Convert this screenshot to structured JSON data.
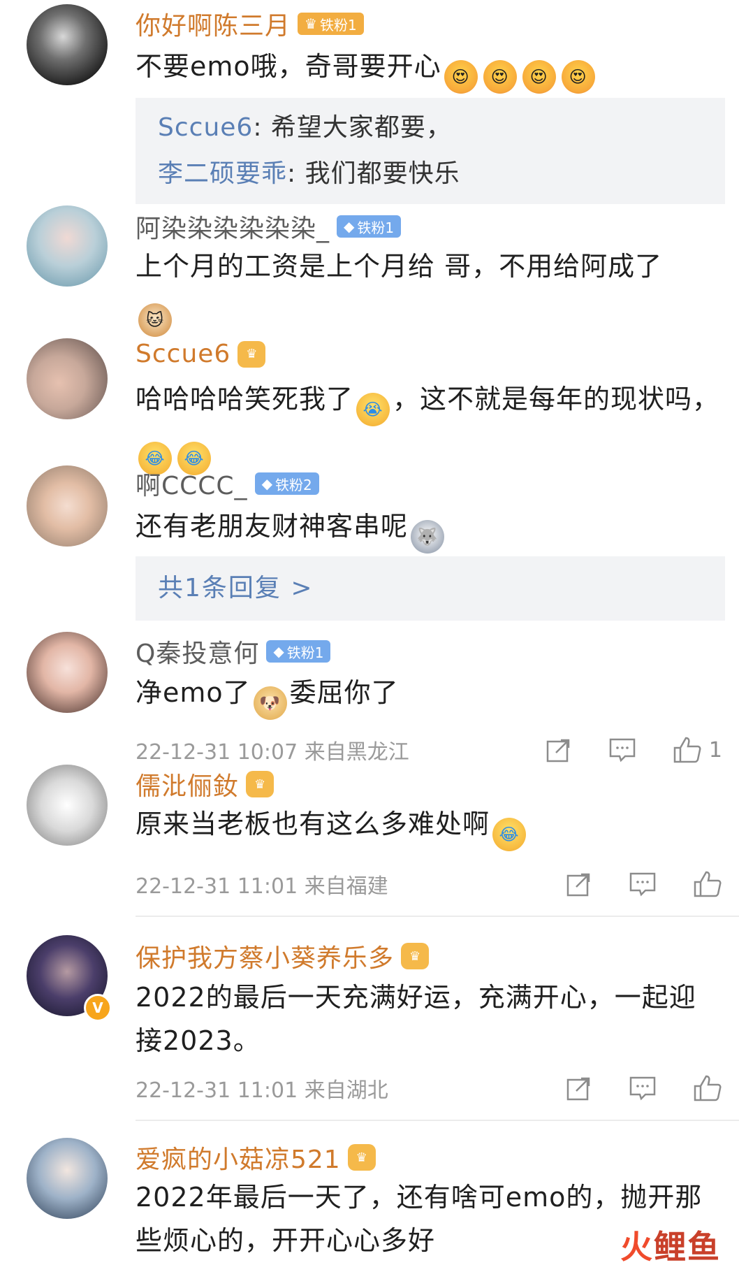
{
  "comments": [
    {
      "username": "你好啊陈三月",
      "badge": "铁粉1",
      "text": "不要emo哦，奇哥要开心",
      "replies": [
        {
          "user": "Sccue6",
          "text": ": 希望大家都要，"
        },
        {
          "user": "李二硕要乖",
          "text": ": 我们都要快乐"
        }
      ]
    },
    {
      "username": "阿染染染染染染_",
      "badge": "铁粉1",
      "text": "上个月的工资是上个月给 哥，不用给阿成了"
    },
    {
      "username": "Sccue6",
      "text_before": "哈哈哈哈笑死我了",
      "text_after": "，这不就是每年的现状吗，"
    },
    {
      "username": "啊CCCC_",
      "badge": "铁粉2",
      "text": "还有老朋友财神客串呢",
      "more_replies": "共1条回复 >"
    },
    {
      "username": "Q秦投意何",
      "badge": "铁粉1",
      "text_before": "净emo了",
      "text_after": "委屈你了",
      "meta": "22-12-31 10:07 来自黑龙江",
      "likes": "1"
    },
    {
      "username": "儒沘俪釹",
      "text": "原来当老板也有这么多难处啊",
      "meta": "22-12-31 11:01 来自福建"
    },
    {
      "username": "保护我方蔡小葵养乐多",
      "text": "2022的最后一天充满好运，充满开心，一起迎接2023。",
      "meta": "22-12-31 11:01 来自湖北"
    },
    {
      "username": "爱疯的小菇凉521",
      "text": "2022年最后一天了，还有啥可emo的，抛开那些烦心的，开开心心多好"
    }
  ],
  "watermark": {
    "fire": "火",
    "rest": "鲤鱼"
  },
  "colors": {
    "gold_name": "#d07a2c",
    "reply_blue": "#5a7fb5",
    "meta_gray": "#9a9a9a"
  }
}
